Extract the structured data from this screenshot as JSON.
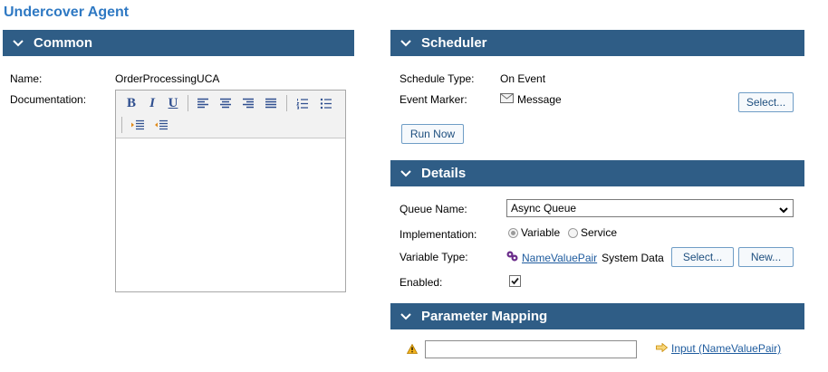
{
  "page": {
    "title": "Undercover Agent"
  },
  "common": {
    "header": "Common",
    "name_label": "Name:",
    "name_value": "OrderProcessingUCA",
    "documentation_label": "Documentation:"
  },
  "scheduler": {
    "header": "Scheduler",
    "schedule_type_label": "Schedule Type:",
    "schedule_type_value": "On Event",
    "event_marker_label": "Event Marker:",
    "event_marker_value": "Message",
    "select_button": "Select...",
    "run_now_button": "Run Now"
  },
  "details": {
    "header": "Details",
    "queue_name_label": "Queue Name:",
    "queue_name_value": "Async Queue",
    "implementation_label": "Implementation:",
    "implementation_options": [
      "Variable",
      "Service"
    ],
    "implementation_selected": "Variable",
    "variable_type_label": "Variable Type:",
    "variable_type_link": "NameValuePair",
    "variable_type_suffix": "System Data",
    "select_button": "Select...",
    "new_button": "New...",
    "enabled_label": "Enabled:",
    "enabled_checked": true
  },
  "parameter_mapping": {
    "header": "Parameter Mapping",
    "input_value": "",
    "mapping_link": "Input (NameValuePair)"
  },
  "colors": {
    "header_bg": "#2f5d86",
    "title_color": "#2f79c3",
    "link_color": "#1e5b9e"
  }
}
